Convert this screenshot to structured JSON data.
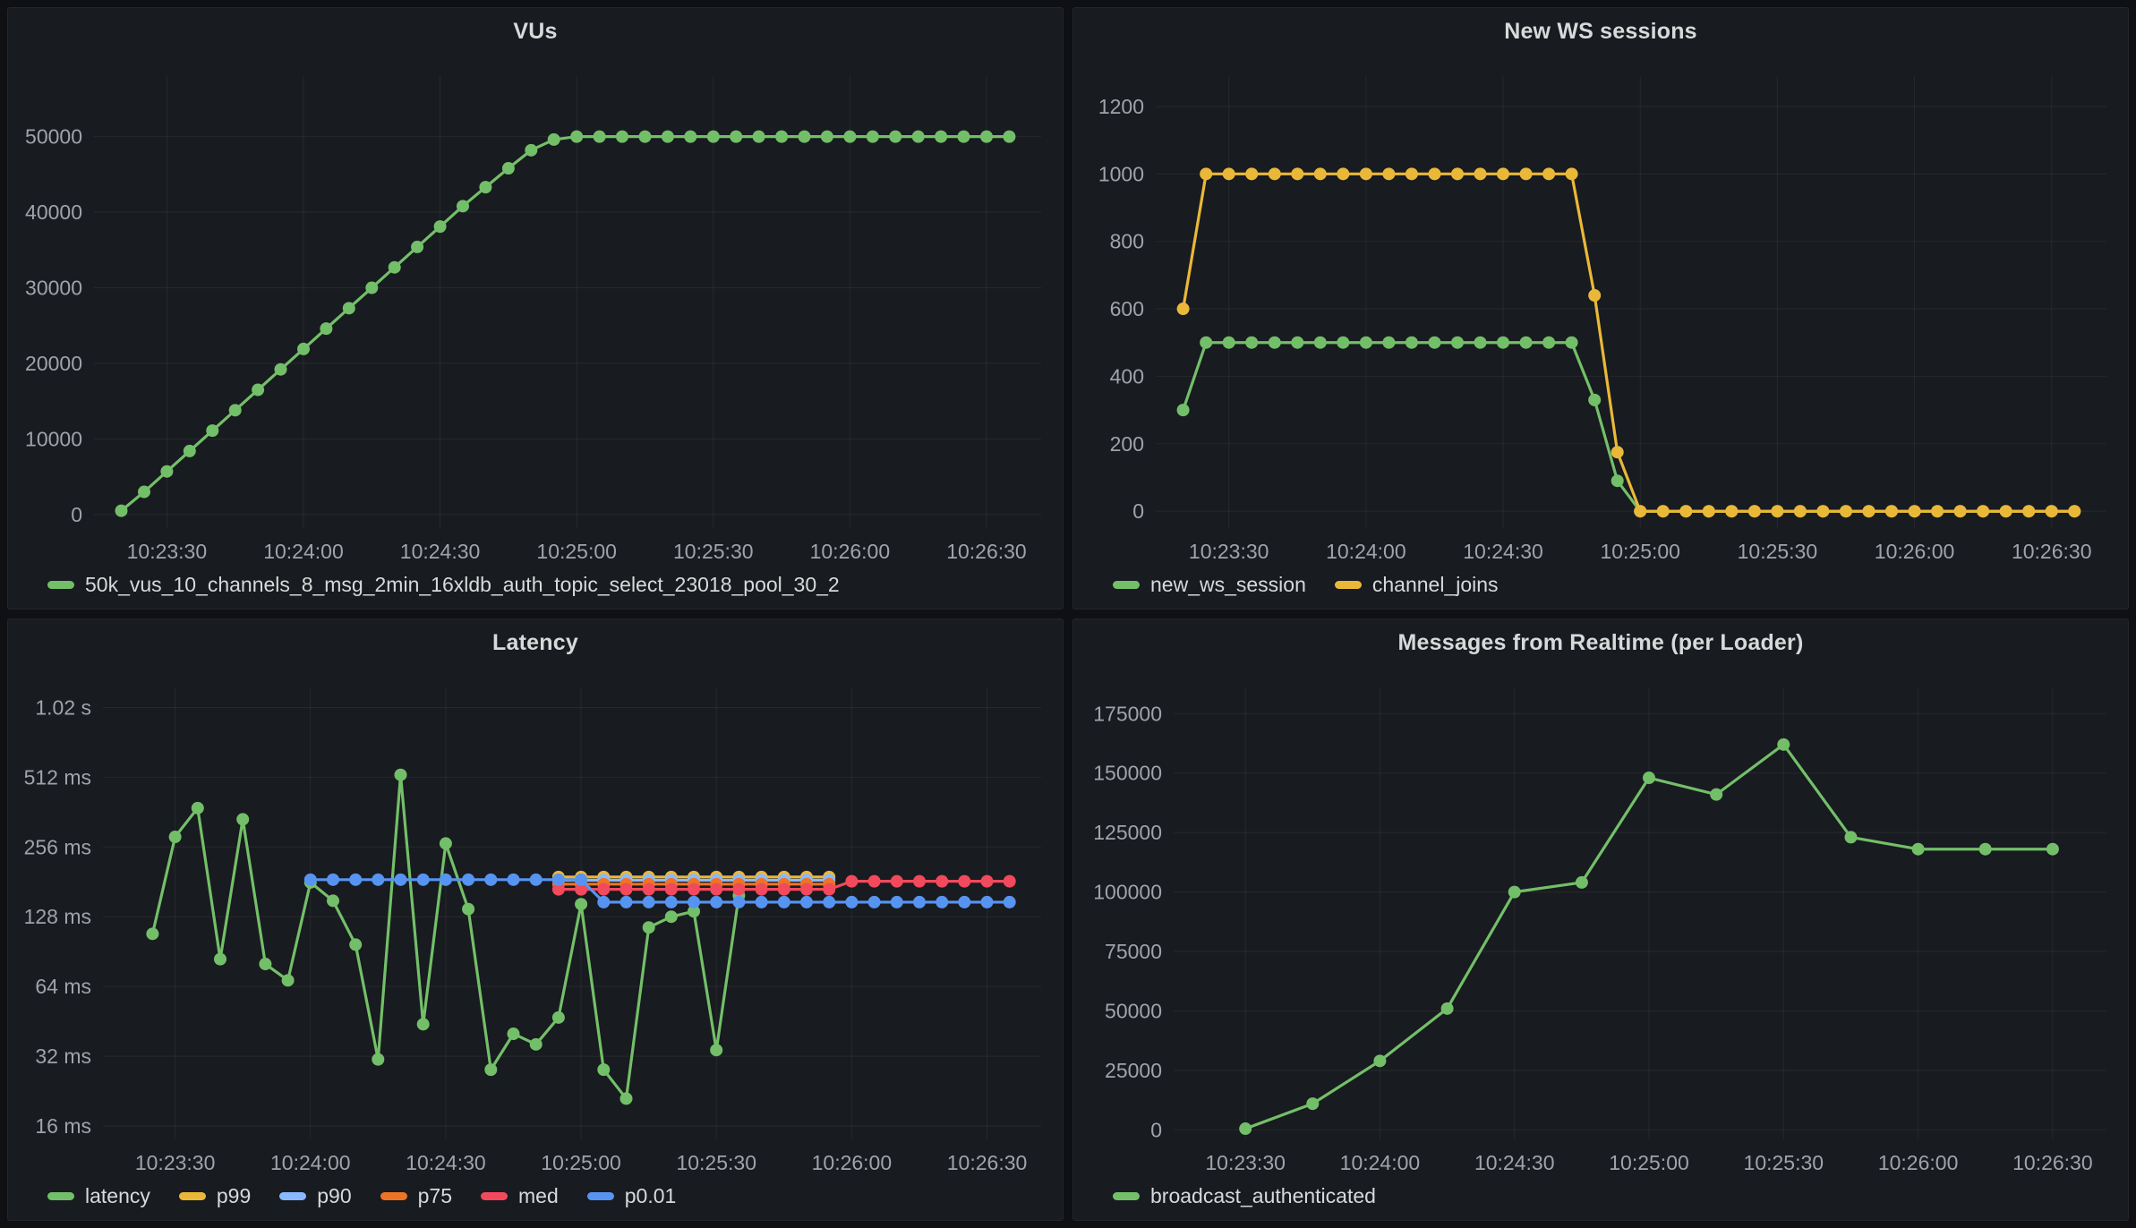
{
  "accent_colors": {
    "green": "#73bf69",
    "yellow": "#eab839",
    "light_blue": "#8ab8ff",
    "orange": "#ed7327",
    "red": "#f2495c",
    "blue": "#5794f2",
    "panel_bg": "#181b1f",
    "page_bg": "#0f1013",
    "text": "#d8d9da",
    "axis_text": "#a1a3ab"
  },
  "chart_data": [
    {
      "type": "line",
      "title": "VUs",
      "x_ticks": [
        "10:23:30",
        "10:24:00",
        "10:24:30",
        "10:25:00",
        "10:25:30",
        "10:26:00",
        "10:26:30"
      ],
      "x_range": [
        "10:23:14",
        "10:26:42"
      ],
      "y_scale": "linear",
      "y_ticks": [
        0,
        10000,
        20000,
        30000,
        40000,
        50000
      ],
      "y_tick_labels": [
        "0",
        "10000",
        "20000",
        "30000",
        "40000",
        "50000"
      ],
      "y_domain": [
        -1800,
        58000
      ],
      "grid": true,
      "legend_position": "bottom",
      "series": [
        {
          "name": "50k_vus_10_channels_8_msg_2min_16xldb_auth_topic_select_23018_pool_30_2",
          "color": "#73bf69",
          "start": "10:23:20",
          "step_s": 5,
          "values": [
            500,
            3000,
            5700,
            8400,
            11100,
            13800,
            16500,
            19200,
            21900,
            24600,
            27300,
            30000,
            32700,
            35400,
            38100,
            40800,
            43300,
            45800,
            48200,
            49600,
            50000,
            50000,
            50000,
            50000,
            50000,
            50000,
            50000,
            50000,
            50000,
            50000,
            50000,
            50000,
            50000,
            50000,
            50000,
            50000,
            50000,
            50000,
            50000,
            50000
          ]
        }
      ]
    },
    {
      "type": "line",
      "title": "New WS sessions",
      "x_ticks": [
        "10:23:30",
        "10:24:00",
        "10:24:30",
        "10:25:00",
        "10:25:30",
        "10:26:00",
        "10:26:30"
      ],
      "x_range": [
        "10:23:14",
        "10:26:42"
      ],
      "y_scale": "linear",
      "y_ticks": [
        0,
        200,
        400,
        600,
        800,
        1000,
        1200
      ],
      "y_tick_labels": [
        "0",
        "200",
        "400",
        "600",
        "800",
        "1000",
        "1200"
      ],
      "y_domain": [
        -50,
        1290
      ],
      "grid": true,
      "legend_position": "bottom",
      "series": [
        {
          "name": "new_ws_session",
          "color": "#73bf69",
          "start": "10:23:20",
          "step_s": 5,
          "values": [
            300,
            500,
            500,
            500,
            500,
            500,
            500,
            500,
            500,
            500,
            500,
            500,
            500,
            500,
            500,
            500,
            500,
            500,
            330,
            90,
            0,
            0,
            0,
            0,
            0,
            0,
            0,
            0,
            0,
            0,
            0,
            0,
            0,
            0,
            0,
            0,
            0,
            0,
            0,
            0
          ]
        },
        {
          "name": "channel_joins",
          "color": "#eab839",
          "start": "10:23:20",
          "step_s": 5,
          "values": [
            600,
            1000,
            1000,
            1000,
            1000,
            1000,
            1000,
            1000,
            1000,
            1000,
            1000,
            1000,
            1000,
            1000,
            1000,
            1000,
            1000,
            1000,
            640,
            175,
            0,
            0,
            0,
            0,
            0,
            0,
            0,
            0,
            0,
            0,
            0,
            0,
            0,
            0,
            0,
            0,
            0,
            0,
            0,
            0
          ]
        }
      ]
    },
    {
      "type": "line",
      "title": "Latency",
      "x_ticks": [
        "10:23:30",
        "10:24:00",
        "10:24:30",
        "10:25:00",
        "10:25:30",
        "10:26:00",
        "10:26:30"
      ],
      "x_range": [
        "10:23:14",
        "10:26:42"
      ],
      "y_scale": "log2",
      "y_ticks": [
        16,
        32,
        64,
        128,
        256,
        512,
        1024
      ],
      "y_tick_labels": [
        "16 ms",
        "32 ms",
        "64 ms",
        "128 ms",
        "256 ms",
        "512 ms",
        "1.02 s"
      ],
      "y_domain": [
        14,
        1250
      ],
      "grid": true,
      "legend_position": "bottom",
      "series": [
        {
          "name": "latency",
          "color": "#73bf69",
          "start": "10:23:25",
          "step_s": 5,
          "values": [
            108,
            283,
            377,
            84,
            337,
            80,
            68,
            180,
            150,
            97,
            31,
            524,
            44,
            265,
            138,
            28,
            40,
            36,
            47,
            145,
            28,
            21,
            115,
            128,
            135,
            34,
            158
          ]
        },
        {
          "name": "p99",
          "color": "#eab839",
          "start": "10:24:55",
          "step_s": 5,
          "values": [
            190,
            190,
            190,
            190,
            190,
            190,
            190,
            190,
            190,
            190,
            190,
            190,
            190
          ]
        },
        {
          "name": "p90",
          "color": "#8ab8ff",
          "start": "10:24:55",
          "step_s": 5,
          "values": [
            184,
            184,
            184,
            184,
            184,
            184,
            184,
            184,
            184,
            184,
            184,
            184,
            184
          ]
        },
        {
          "name": "p75",
          "color": "#ed7327",
          "start": "10:24:55",
          "step_s": 5,
          "values": [
            177,
            177,
            177,
            177,
            177,
            177,
            177,
            177,
            177,
            177,
            177,
            177,
            177
          ]
        },
        {
          "name": "med",
          "color": "#f2495c",
          "start": "10:24:55",
          "step_s": 5,
          "values": [
            168,
            168,
            168,
            168,
            168,
            168,
            168,
            168,
            168,
            168,
            168,
            168,
            168,
            182,
            182,
            182,
            182,
            182,
            182,
            182,
            182
          ]
        },
        {
          "name": "p0.01",
          "color": "#5794f2",
          "start": "10:24:00",
          "step_s": 5,
          "values": [
            185,
            185,
            185,
            185,
            185,
            185,
            185,
            185,
            185,
            185,
            185,
            185,
            185,
            148,
            148,
            148,
            148,
            148,
            148,
            148,
            148,
            148,
            148,
            148,
            148,
            148,
            148,
            148,
            148,
            148,
            148,
            148
          ]
        }
      ]
    },
    {
      "type": "line",
      "title": "Messages from Realtime (per Loader)",
      "x_ticks": [
        "10:23:30",
        "10:24:00",
        "10:24:30",
        "10:25:00",
        "10:25:30",
        "10:26:00",
        "10:26:30"
      ],
      "x_range": [
        "10:23:14",
        "10:26:42"
      ],
      "y_scale": "linear",
      "y_ticks": [
        0,
        25000,
        50000,
        75000,
        100000,
        125000,
        150000,
        175000
      ],
      "y_tick_labels": [
        "0",
        "25000",
        "50000",
        "75000",
        "100000",
        "125000",
        "150000",
        "175000"
      ],
      "y_domain": [
        -4000,
        186000
      ],
      "grid": true,
      "legend_position": "bottom",
      "series": [
        {
          "name": "broadcast_authenticated",
          "color": "#73bf69",
          "start": "10:23:30",
          "step_s": 15,
          "values": [
            500,
            11000,
            29000,
            51000,
            100000,
            104000,
            148000,
            141000,
            162000,
            123000,
            118000,
            118000,
            118000
          ]
        }
      ]
    }
  ]
}
